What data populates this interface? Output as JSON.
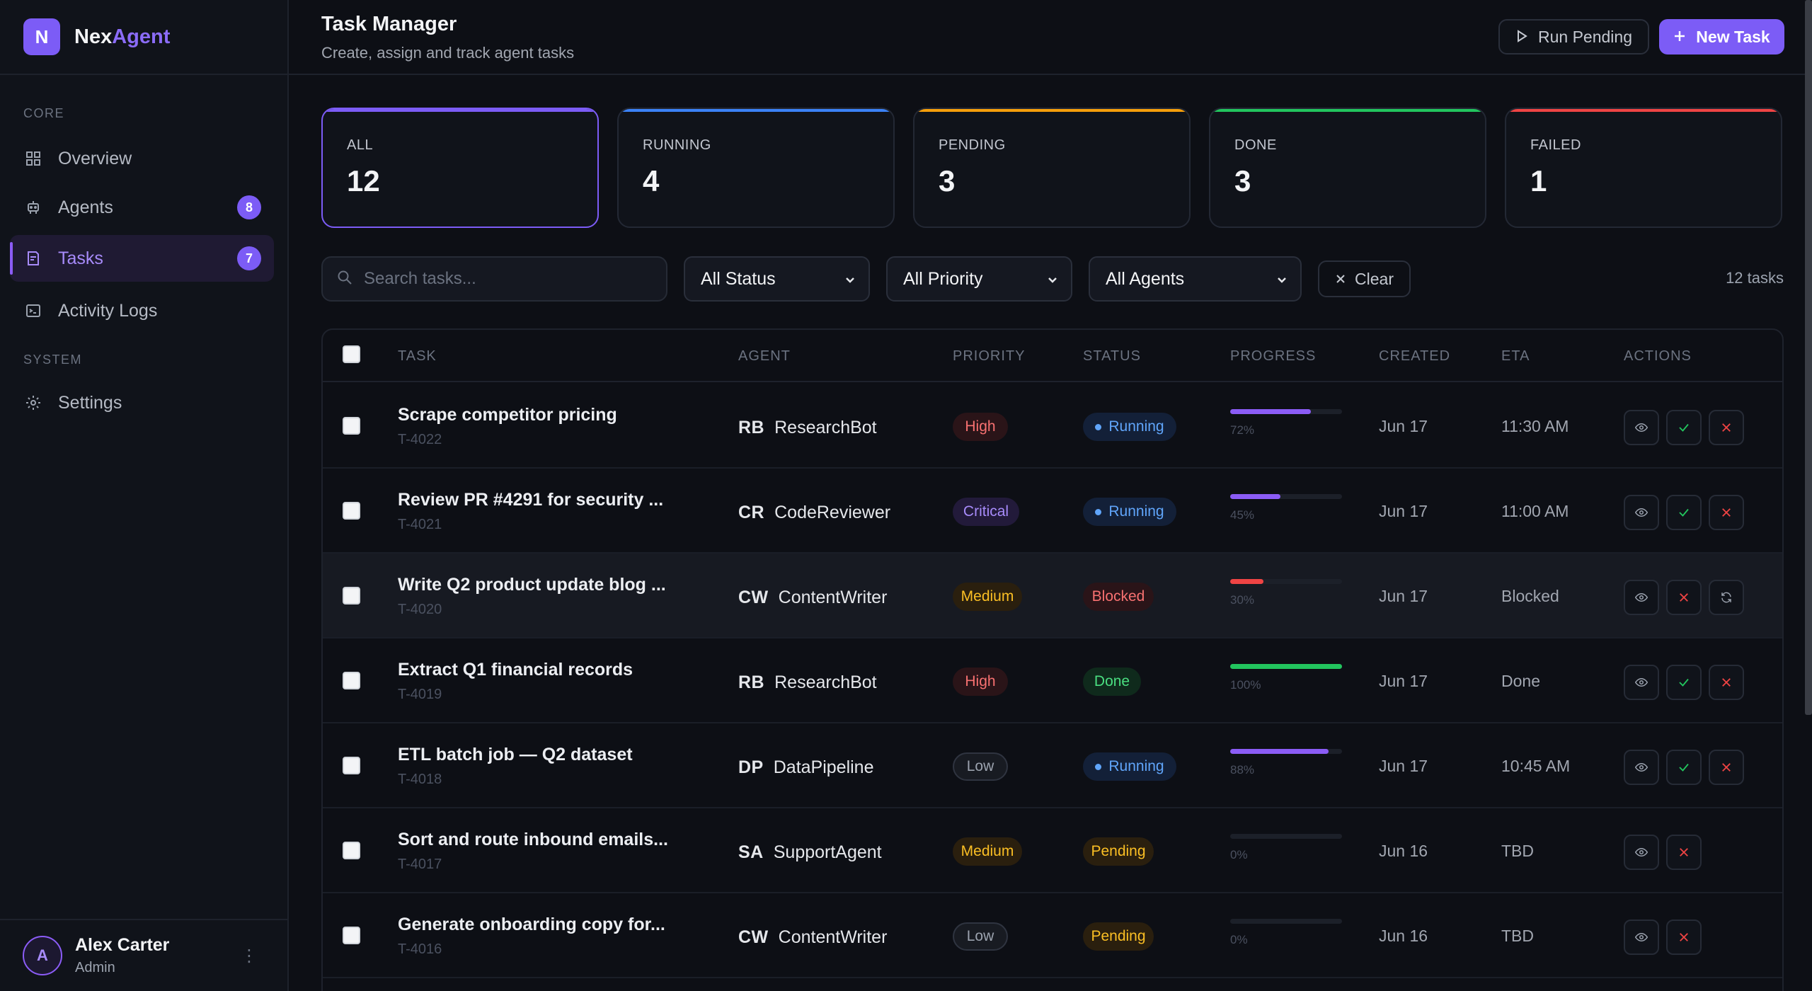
{
  "brand": {
    "logo_letter": "N",
    "name_a": "Nex",
    "name_b": "Agent",
    "accent_color": "#8b6cf8"
  },
  "sidebar": {
    "sections": [
      {
        "label": "CORE"
      },
      {
        "label": "SYSTEM"
      }
    ],
    "items": [
      {
        "label": "Overview",
        "icon": "grid-icon"
      },
      {
        "label": "Agents",
        "icon": "robot-icon",
        "badge": "8"
      },
      {
        "label": "Tasks",
        "icon": "task-list-icon",
        "badge": "7",
        "active": true
      },
      {
        "label": "Activity Logs",
        "icon": "terminal-icon"
      },
      {
        "label": "Settings",
        "icon": "gear-icon"
      }
    ],
    "user": {
      "initial": "A",
      "name": "Alex Carter",
      "role": "Admin"
    }
  },
  "header": {
    "title": "Task Manager",
    "subtitle": "Create, assign and track agent tasks",
    "run_pending_label": "Run Pending",
    "new_task_label": "New Task"
  },
  "stats": [
    {
      "label": "ALL",
      "value": "12",
      "color": "#7c5cf6"
    },
    {
      "label": "RUNNING",
      "value": "4",
      "color": "#3b82f6"
    },
    {
      "label": "PENDING",
      "value": "3",
      "color": "#f59e0b"
    },
    {
      "label": "DONE",
      "value": "3",
      "color": "#22c55e"
    },
    {
      "label": "FAILED",
      "value": "1",
      "color": "#ef4444"
    }
  ],
  "filters": {
    "search_placeholder": "Search tasks...",
    "status": "All Status",
    "priority": "All Priority",
    "agents": "All Agents",
    "clear_label": "Clear",
    "count_text": "12 tasks"
  },
  "table": {
    "columns": [
      "TASK",
      "AGENT",
      "PRIORITY",
      "STATUS",
      "PROGRESS",
      "CREATED",
      "ETA",
      "ACTIONS"
    ],
    "rows": [
      {
        "title": "Scrape competitor pricing",
        "id": "T-4022",
        "agent_init": "RB",
        "agent": "ResearchBot",
        "priority": "High",
        "status": "Running",
        "progress": 0.72,
        "progress_text": "72%",
        "created": "Jun 17",
        "eta": "11:30 AM",
        "actions": [
          "view",
          "approve",
          "cancel"
        ]
      },
      {
        "title": "Review PR #4291 for security ...",
        "id": "T-4021",
        "agent_init": "CR",
        "agent": "CodeReviewer",
        "priority": "Critical",
        "status": "Running",
        "progress": 0.45,
        "progress_text": "45%",
        "created": "Jun 17",
        "eta": "11:00 AM",
        "actions": [
          "view",
          "approve",
          "cancel"
        ]
      },
      {
        "title": "Write Q2 product update blog ...",
        "id": "T-4020",
        "agent_init": "CW",
        "agent": "ContentWriter",
        "priority": "Medium",
        "status": "Blocked",
        "progress": 0.3,
        "progress_text": "30%",
        "created": "Jun 17",
        "eta": "Blocked",
        "actions": [
          "view",
          "cancel",
          "retry"
        ]
      },
      {
        "title": "Extract Q1 financial records",
        "id": "T-4019",
        "agent_init": "RB",
        "agent": "ResearchBot",
        "priority": "High",
        "status": "Done",
        "progress": 1.0,
        "progress_text": "100%",
        "created": "Jun 17",
        "eta": "Done",
        "actions": [
          "view",
          "approve",
          "cancel"
        ]
      },
      {
        "title": "ETL batch job — Q2 dataset",
        "id": "T-4018",
        "agent_init": "DP",
        "agent": "DataPipeline",
        "priority": "Low",
        "status": "Running",
        "progress": 0.88,
        "progress_text": "88%",
        "created": "Jun 17",
        "eta": "10:45 AM",
        "actions": [
          "view",
          "approve",
          "cancel"
        ]
      },
      {
        "title": "Sort and route inbound emails...",
        "id": "T-4017",
        "agent_init": "SA",
        "agent": "SupportAgent",
        "priority": "Medium",
        "status": "Pending",
        "progress": 0.0,
        "progress_text": "0%",
        "created": "Jun 16",
        "eta": "TBD",
        "actions": [
          "view",
          "cancel"
        ]
      },
      {
        "title": "Generate onboarding copy for...",
        "id": "T-4016",
        "agent_init": "CW",
        "agent": "ContentWriter",
        "priority": "Low",
        "status": "Pending",
        "progress": 0.0,
        "progress_text": "0%",
        "created": "Jun 16",
        "eta": "TBD",
        "actions": [
          "view",
          "cancel"
        ]
      }
    ]
  }
}
